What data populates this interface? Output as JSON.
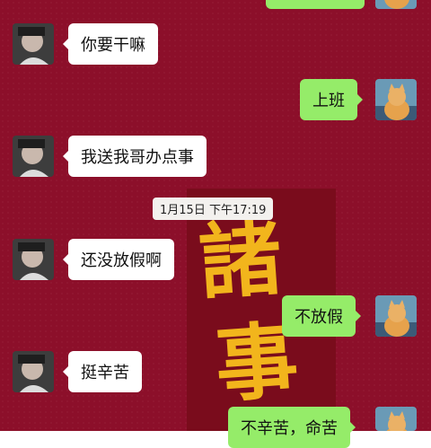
{
  "chat": {
    "timestamp": "1月15日 下午17:19",
    "messages": [
      {
        "side": "left",
        "text": "你要干嘛"
      },
      {
        "side": "right",
        "text": "上班"
      },
      {
        "side": "left",
        "text": "我送我哥办点事"
      },
      {
        "side": "left",
        "text": "还没放假啊"
      },
      {
        "side": "right",
        "text": "不放假"
      },
      {
        "side": "left",
        "text": "挺辛苦"
      },
      {
        "side": "right",
        "text": "不辛苦，命苦"
      }
    ]
  },
  "background": {
    "color": "#8c0f2a",
    "decoration_text": [
      "諸",
      "事"
    ],
    "decoration_color": "#f2b51c"
  },
  "colors": {
    "bubble_left": "#ffffff",
    "bubble_right": "#95ec69"
  }
}
